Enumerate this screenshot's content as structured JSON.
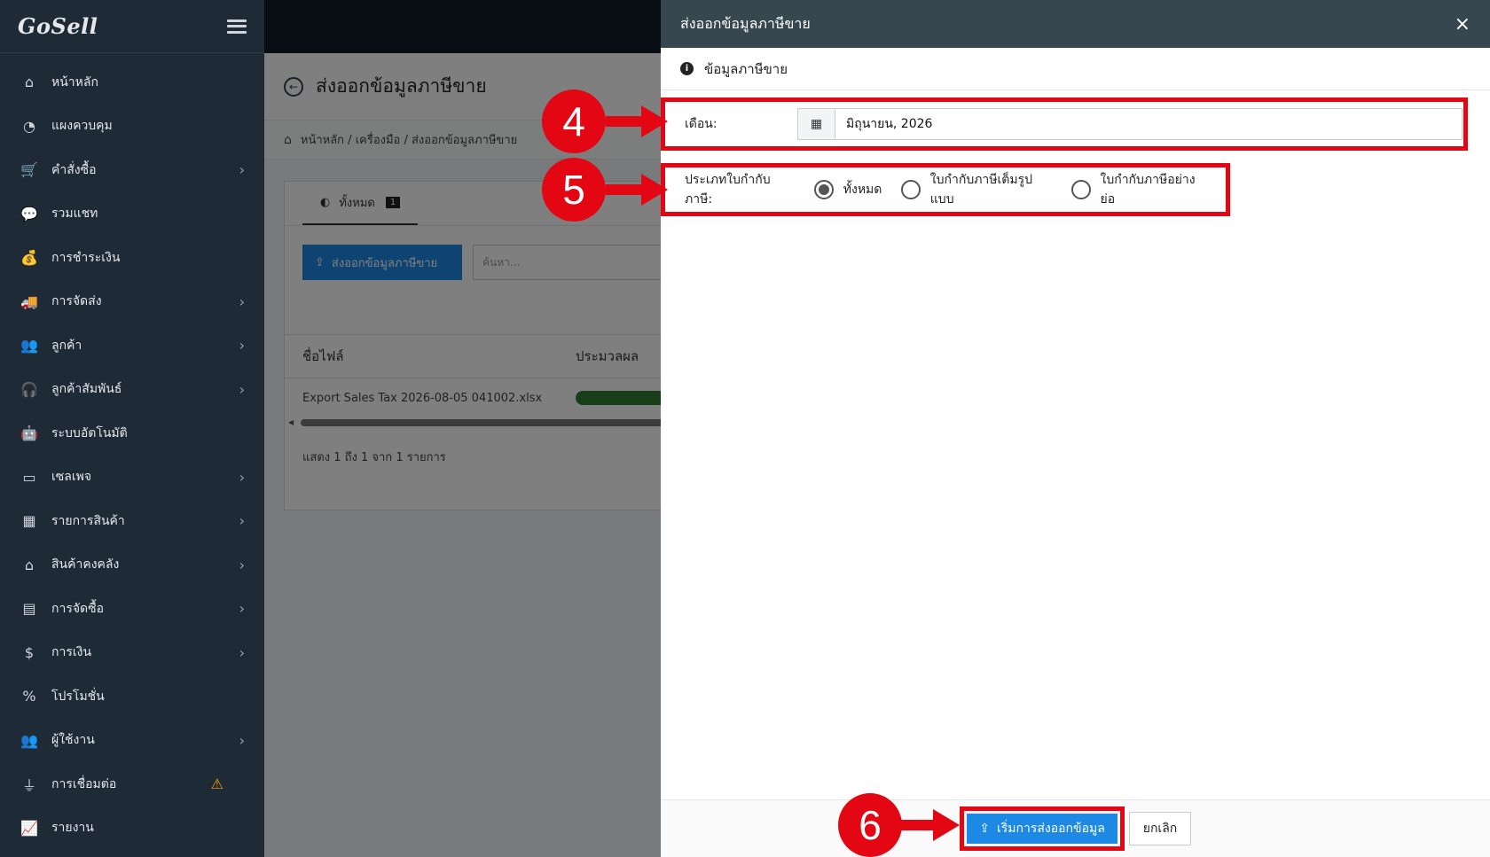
{
  "sidebar": {
    "logo": "GoSell",
    "items": [
      {
        "label": "หน้าหลัก",
        "icon": "home-icon",
        "glyph": "⌂",
        "chevron": false
      },
      {
        "label": "แผงควบคุม",
        "icon": "dashboard-icon",
        "glyph": "◔",
        "chevron": false
      },
      {
        "label": "คำสั่งซื้อ",
        "icon": "cart-icon",
        "glyph": "🛒",
        "chevron": true
      },
      {
        "label": "รวมแชท",
        "icon": "chat-icon",
        "glyph": "💬",
        "chevron": false
      },
      {
        "label": "การชำระเงิน",
        "icon": "money-bag-icon",
        "glyph": "💰",
        "chevron": false
      },
      {
        "label": "การจัดส่ง",
        "icon": "truck-icon",
        "glyph": "🚚",
        "chevron": true
      },
      {
        "label": "ลูกค้า",
        "icon": "users-icon",
        "glyph": "👥",
        "chevron": true
      },
      {
        "label": "ลูกค้าสัมพันธ์",
        "icon": "headset-icon",
        "glyph": "🎧",
        "chevron": true
      },
      {
        "label": "ระบบอัตโนมัติ",
        "icon": "robot-icon",
        "glyph": "🤖",
        "chevron": false
      },
      {
        "label": "เซลเพจ",
        "icon": "window-icon",
        "glyph": "▭",
        "chevron": true
      },
      {
        "label": "รายการสินค้า",
        "icon": "boxes-icon",
        "glyph": "▦",
        "chevron": true
      },
      {
        "label": "สินค้าคงคลัง",
        "icon": "warehouse-icon",
        "glyph": "⌂",
        "chevron": true
      },
      {
        "label": "การจัดซื้อ",
        "icon": "pallet-icon",
        "glyph": "▤",
        "chevron": true
      },
      {
        "label": "การเงิน",
        "icon": "dollar-icon",
        "glyph": "$",
        "chevron": true
      },
      {
        "label": "โปรโมชั่น",
        "icon": "percent-icon",
        "glyph": "%",
        "chevron": false
      },
      {
        "label": "ผู้ใช้งาน",
        "icon": "user-group-icon",
        "glyph": "👥",
        "chevron": true
      },
      {
        "label": "การเชื่อมต่อ",
        "icon": "plug-icon",
        "glyph": "⏚",
        "chevron": false,
        "warning": true
      },
      {
        "label": "รายงาน",
        "icon": "chart-icon",
        "glyph": "📈",
        "chevron": false
      }
    ]
  },
  "page": {
    "title": "ส่งออกข้อมูลภาษีขาย",
    "breadcrumb": "หน้าหลัก / เครื่องมือ / ส่งออกข้อมูลภาษีขาย",
    "tab_label": "ทั้งหมด",
    "tab_count": "1",
    "export_button": "ส่งออกข้อมูลภาษีขาย",
    "search_placeholder": "ค้นหา...",
    "table": {
      "col_filename": "ชื่อไฟล์",
      "col_progress": "ประมวลผล",
      "row_filename": "Export Sales Tax 2026-08-05 041002.xlsx",
      "progress": 1.0
    },
    "footer": "แสดง 1 ถึง 1 จาก 1 รายการ"
  },
  "drawer": {
    "title": "ส่งออกข้อมูลภาษีขาย",
    "section": "ข้อมูลภาษีขาย",
    "month_label": "เดือน:",
    "month_value": "มิถุนายน, 2026",
    "type_label": "ประเภทใบกำกับภาษี:",
    "options": [
      "ทั้งหมด",
      "ใบกำกับภาษีเต็มรูปแบบ",
      "ใบกำกับภาษีอย่างย่อ"
    ],
    "selected_option": 0,
    "start_button": "เริ่มการส่งออกข้อมูล",
    "cancel_button": "ยกเลิก"
  },
  "annotations": {
    "step4": "4",
    "step5": "5",
    "step6": "6",
    "color": "#e30613"
  },
  "colors": {
    "sidebar_bg": "#1f2a37",
    "drawer_header_bg": "#37474f",
    "primary": "#1e88e5",
    "progress": "#2e7d32"
  }
}
